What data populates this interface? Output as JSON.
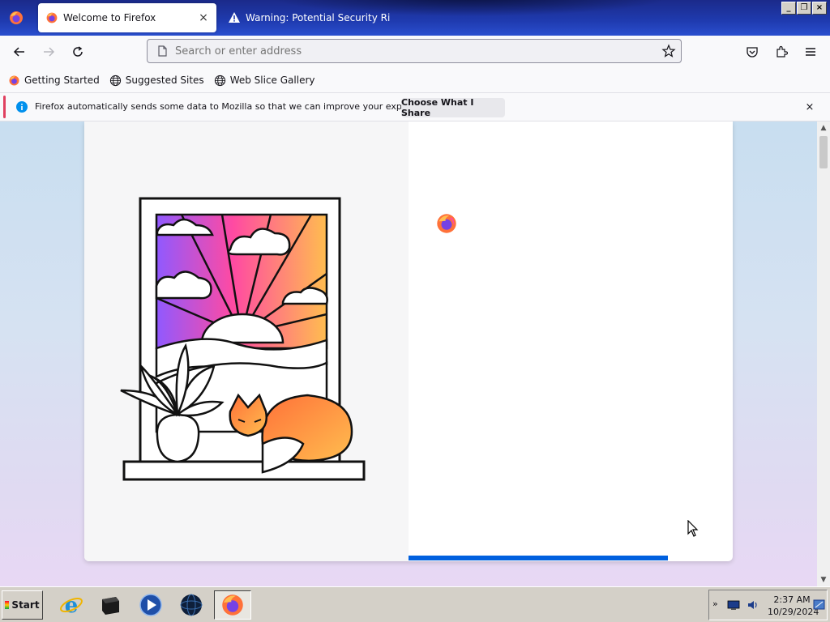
{
  "tabs": [
    {
      "title": "Welcome to Firefox",
      "active": true,
      "close_label": "×"
    },
    {
      "title": "Warning: Potential Security Risk",
      "active": false
    }
  ],
  "window_controls": [
    "_",
    "❐",
    "×"
  ],
  "navbar": {
    "url_placeholder": "Search or enter address",
    "url_value": ""
  },
  "bookmarks": [
    {
      "label": "Getting Started",
      "icon": "firefox-icon"
    },
    {
      "label": "Suggested Sites",
      "icon": "globe-icon"
    },
    {
      "label": "Web Slice Gallery",
      "icon": "globe-icon"
    }
  ],
  "notification": {
    "message": "Firefox automatically sends some data to Mozilla so that we can improve your experience.",
    "button_label": "Choose What I Share",
    "close_label": "×"
  },
  "welcome": {
    "progress": 0.8
  },
  "colors": {
    "tabstrip": "#1f3bb0",
    "accent_blue": "#0060df",
    "notification_accent": "#e04060"
  },
  "taskbar": {
    "start_label": "Start",
    "apps": [
      "internet-explorer-icon",
      "terminal-icon",
      "media-player-icon",
      "globe-app-icon",
      "firefox-icon"
    ],
    "tray": {
      "chevron": "»",
      "time": "2:37 AM",
      "date": "10/29/2024"
    }
  }
}
